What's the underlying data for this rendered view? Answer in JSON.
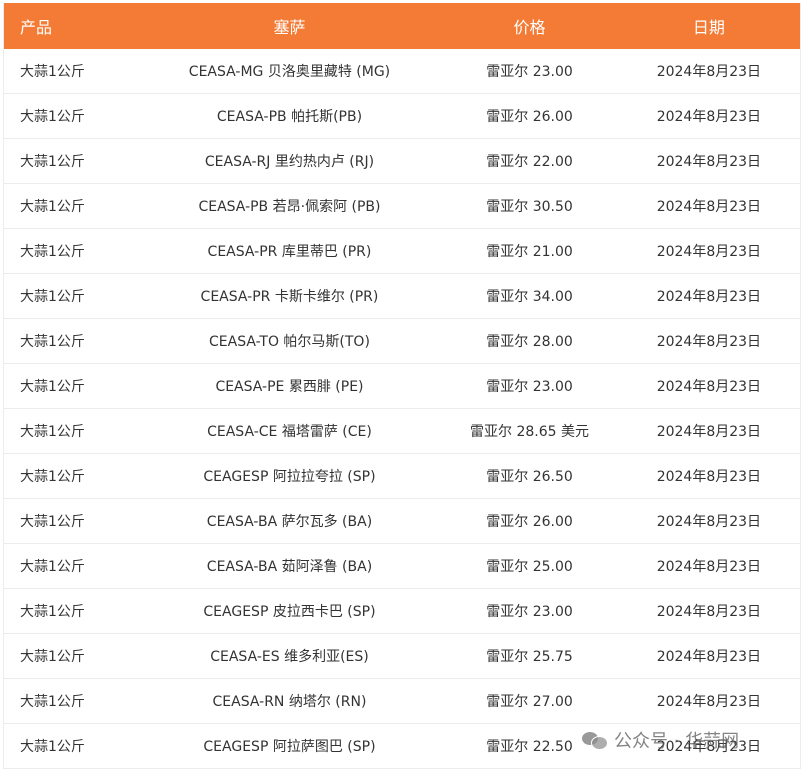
{
  "table": {
    "headers": [
      "产品",
      "塞萨",
      "价格",
      "日期"
    ],
    "rows": [
      [
        "大蒜1公斤",
        "CEASA-MG 贝洛奥里藏特 (MG)",
        "雷亚尔 23.00",
        "2024年8月23日"
      ],
      [
        "大蒜1公斤",
        "CEASA-PB 帕托斯(PB)",
        "雷亚尔 26.00",
        "2024年8月23日"
      ],
      [
        "大蒜1公斤",
        "CEASA-RJ 里约热内卢 (RJ)",
        "雷亚尔 22.00",
        "2024年8月23日"
      ],
      [
        "大蒜1公斤",
        "CEASA-PB 若昂·佩索阿 (PB)",
        "雷亚尔 30.50",
        "2024年8月23日"
      ],
      [
        "大蒜1公斤",
        "CEASA-PR 库里蒂巴 (PR)",
        "雷亚尔 21.00",
        "2024年8月23日"
      ],
      [
        "大蒜1公斤",
        "CEASA-PR 卡斯卡维尔 (PR)",
        "雷亚尔 34.00",
        "2024年8月23日"
      ],
      [
        "大蒜1公斤",
        "CEASA-TO 帕尔马斯(TO)",
        "雷亚尔 28.00",
        "2024年8月23日"
      ],
      [
        "大蒜1公斤",
        "CEASA-PE 累西腓 (PE)",
        "雷亚尔 23.00",
        "2024年8月23日"
      ],
      [
        "大蒜1公斤",
        "CEASA-CE 福塔雷萨 (CE)",
        "雷亚尔 28.65 美元",
        "2024年8月23日"
      ],
      [
        "大蒜1公斤",
        "CEAGESP 阿拉拉夸拉 (SP)",
        "雷亚尔 26.50",
        "2024年8月23日"
      ],
      [
        "大蒜1公斤",
        "CEASA-BA 萨尔瓦多 (BA)",
        "雷亚尔 26.00",
        "2024年8月23日"
      ],
      [
        "大蒜1公斤",
        "CEASA-BA 茹阿泽鲁 (BA)",
        "雷亚尔 25.00",
        "2024年8月23日"
      ],
      [
        "大蒜1公斤",
        "CEAGESP 皮拉西卡巴 (SP)",
        "雷亚尔 23.00",
        "2024年8月23日"
      ],
      [
        "大蒜1公斤",
        "CEASA-ES 维多利亚(ES)",
        "雷亚尔 25.75",
        "2024年8月23日"
      ],
      [
        "大蒜1公斤",
        "CEASA-RN 纳塔尔 (RN)",
        "雷亚尔 27.00",
        "2024年8月23日"
      ],
      [
        "大蒜1公斤",
        "CEAGESP 阿拉萨图巴 (SP)",
        "雷亚尔 22.50",
        "2024年8月23日"
      ]
    ]
  },
  "watermark": {
    "text": "公众号 · 华蒜网",
    "icon": "wechat-icon"
  },
  "colors": {
    "header_bg": "#f47b36",
    "header_text": "#ffffff",
    "row_text": "#333333",
    "border": "#ececec"
  }
}
